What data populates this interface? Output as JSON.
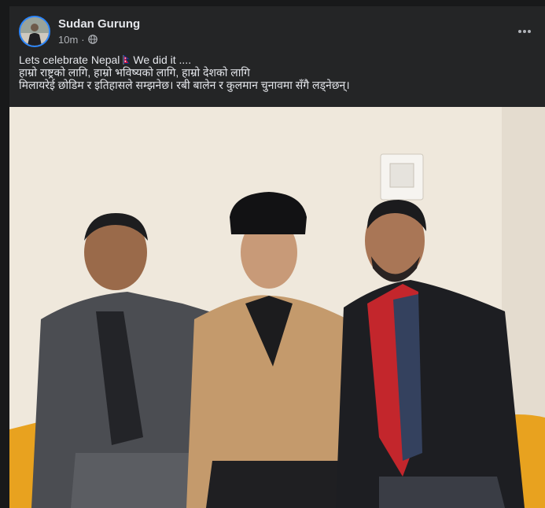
{
  "post": {
    "author": "Sudan Gurung",
    "time": "10m",
    "separator": "·",
    "audience_icon": "globe-icon",
    "more_icon": "more-horizontal-icon",
    "text_line1_a": "Lets celebrate Nepal",
    "text_line1_flag": "nepal-flag-emoji",
    "text_line1_b": "We did it ....",
    "text_line2": "हाम्रो राष्ट्रको लागि, हाम्रो भविष्यको लागि, हाम्रो देशको लागि",
    "text_line3": "मिलायरेई छोडिम र इतिहासले सम्झनेछ। रबी बालेन र कुलमान चुनावमा सँगै लड्नेछन्।"
  },
  "photo": {
    "subject": "post-photo"
  },
  "colors": {
    "background": "#18191a",
    "card": "#242526",
    "text_primary": "#e4e6eb",
    "text_secondary": "#b0b3b8",
    "avatar_ring": "#2d88ff"
  }
}
